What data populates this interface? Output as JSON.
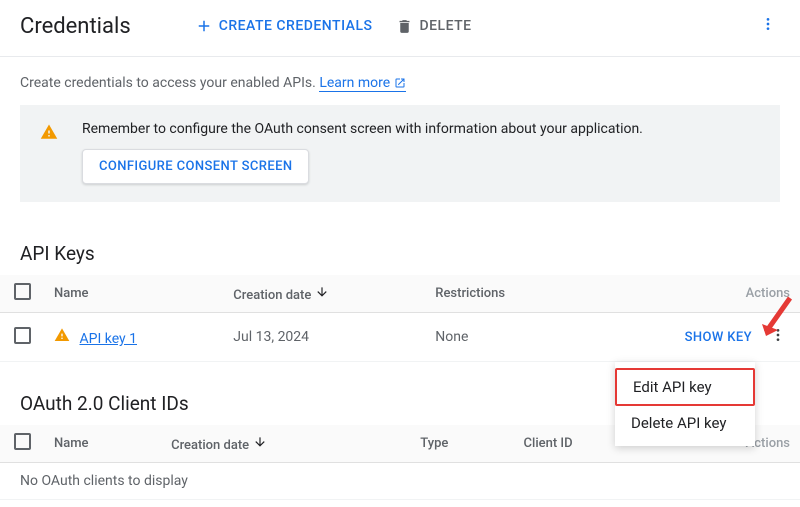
{
  "page": {
    "title": "Credentials",
    "create_btn": "CREATE CREDENTIALS",
    "delete_btn": "DELETE"
  },
  "intro": {
    "text": "Create credentials to access your enabled APIs. ",
    "learn_more": "Learn more"
  },
  "banner": {
    "message": "Remember to configure the OAuth consent screen with information about your application.",
    "button": "CONFIGURE CONSENT SCREEN"
  },
  "api_keys": {
    "title": "API Keys",
    "headers": {
      "name": "Name",
      "creation": "Creation date",
      "restrictions": "Restrictions",
      "actions": "Actions"
    },
    "rows": [
      {
        "name": "API key 1",
        "creation": "Jul 13, 2024",
        "restrictions": "None",
        "show_key": "SHOW KEY"
      }
    ]
  },
  "dropdown": {
    "edit": "Edit API key",
    "delete": "Delete API key"
  },
  "oauth": {
    "title": "OAuth 2.0 Client IDs",
    "headers": {
      "name": "Name",
      "creation": "Creation date",
      "type": "Type",
      "client_id": "Client ID",
      "actions": "Actions"
    },
    "empty": "No OAuth clients to display"
  }
}
